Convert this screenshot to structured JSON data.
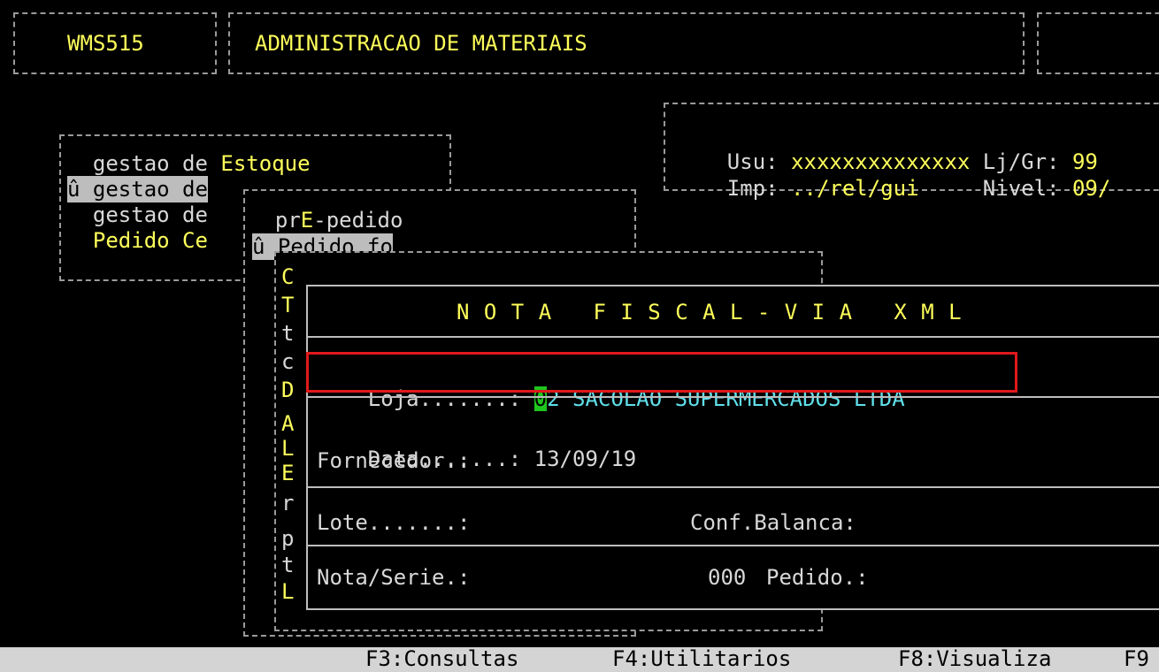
{
  "header": {
    "program_code": "WMS515",
    "title": "ADMINISTRACAO DE MATERIAIS"
  },
  "user_info": {
    "usu_label": "Usu:",
    "usu_value": "xxxxxxxxxxxxxx",
    "lj_label": "Lj/Gr:",
    "lj_value": "99",
    "imp_label": "Imp:",
    "imp_value": "../rel/gui",
    "nivel_label": "Nivel:",
    "nivel_value": "09/"
  },
  "main_menu": {
    "items": [
      {
        "prefix": "  gestao de ",
        "suffix": "Estoque"
      },
      {
        "prefix": "û gestao de",
        "suffix": ""
      },
      {
        "prefix": "  gestao de",
        "suffix": ""
      },
      {
        "prefix": "  ",
        "suffix": "Pedido Ce"
      }
    ]
  },
  "sub_menu": {
    "items": [
      {
        "prefix": "  pr",
        "hot": "E",
        "rest": "-pedido"
      },
      {
        "prefix": "û ",
        "hot": "",
        "rest": "Pedido fo"
      }
    ]
  },
  "third_menu": {
    "letters": [
      "C",
      "T",
      "t",
      "c",
      "D",
      "A",
      "L",
      "E",
      "r",
      "p",
      "t",
      "L"
    ]
  },
  "nota_fiscal": {
    "title": "N O T A   F I S C A L - V I A   X M L",
    "loja_label": "Loja.......: ",
    "loja_cursor_digit": "0",
    "loja_value_rest": "2 SACOLAO SUPERMERCADOS LTDA",
    "data_label": "Data.......: ",
    "data_value": "13/09/19",
    "fornecedor_label": "Fornecedor.:",
    "lote_label": "Lote.......:",
    "conf_balanca_label": "Conf.Balanca:",
    "nota_serie_label": "Nota/Serie.:",
    "nota_serie_value": "000",
    "pedido_label": "Pedido.:"
  },
  "function_keys": [
    {
      "label": "F3:Consultas"
    },
    {
      "label": "F4:Utilitarios"
    },
    {
      "label": "F8:Visualiza"
    },
    {
      "label": "F9"
    }
  ],
  "colors": {
    "background": "#000000",
    "text": "#d8d8d8",
    "hotkey": "#ffff5a",
    "cyan_value": "#5fe0ea",
    "cursor": "#1ec51e",
    "highlight_box": "#e0191b",
    "function_bar": "#d4d4d4"
  }
}
